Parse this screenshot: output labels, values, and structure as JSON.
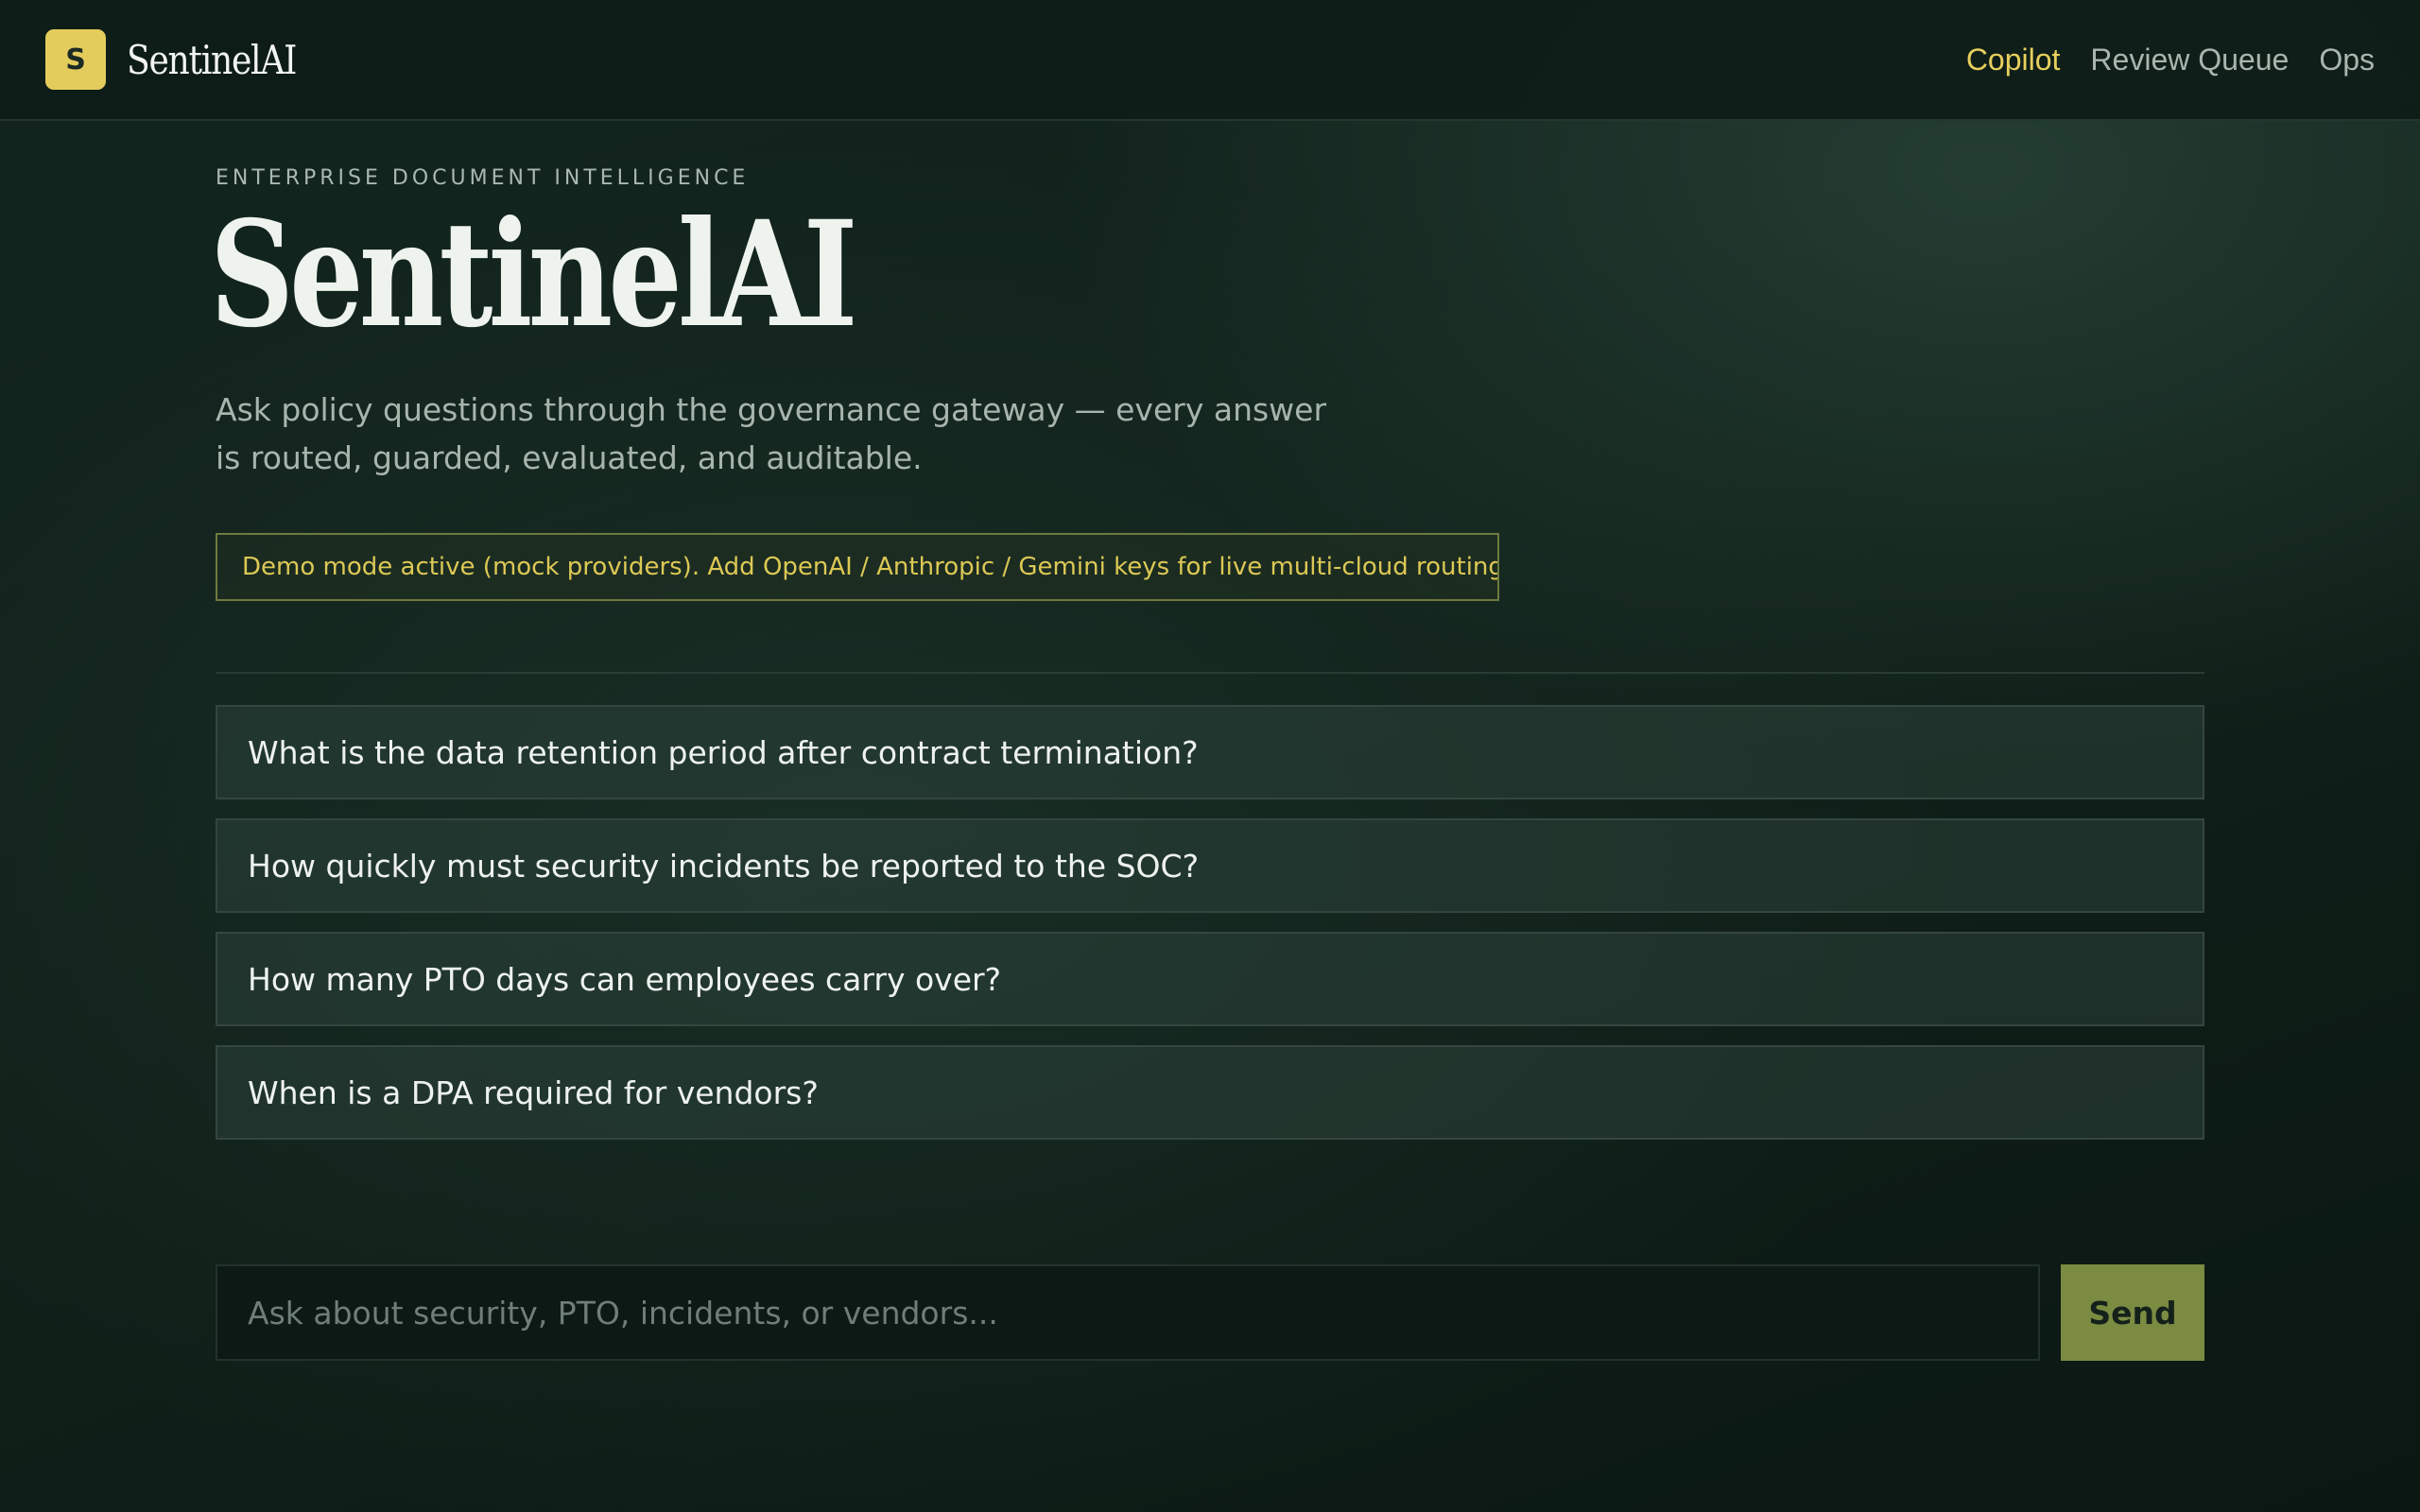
{
  "brand": {
    "logo_letter": "S",
    "name": "SentinelAI"
  },
  "nav": {
    "items": [
      {
        "label": "Copilot",
        "active": true
      },
      {
        "label": "Review Queue",
        "active": false
      },
      {
        "label": "Ops",
        "active": false
      }
    ]
  },
  "hero": {
    "eyebrow": "ENTERPRISE DOCUMENT INTELLIGENCE",
    "title": "SentinelAI",
    "subtitle": "Ask policy questions through the governance gateway — every answer is routed, guarded, evaluated, and auditable."
  },
  "notice": {
    "text": "Demo mode active (mock providers). Add OpenAI / Anthropic / Gemini keys for live multi-cloud routing."
  },
  "suggestions": [
    "What is the data retention period after contract termination?",
    "How quickly must security incidents be reported to the SOC?",
    "How many PTO days can employees carry over?",
    "When is a DPA required for vendors?"
  ],
  "ask": {
    "placeholder": "Ask about security, PTO, incidents, or vendors...",
    "value": "",
    "send_label": "Send"
  },
  "colors": {
    "accent": "#e6cf5c",
    "send_button": "#7b8b42",
    "background": "#0f1f1a"
  }
}
